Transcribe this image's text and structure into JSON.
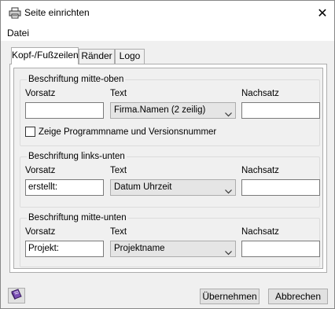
{
  "window": {
    "title": "Seite einrichten",
    "close_glyph": "✕"
  },
  "menu": {
    "items": [
      "Datei"
    ]
  },
  "tabs": [
    {
      "label": "Kopf-/Fußzeilen",
      "active": true
    },
    {
      "label": "Ränder",
      "active": false
    },
    {
      "label": "Logo",
      "active": false
    }
  ],
  "groups": [
    {
      "title": "Beschriftung mitte-oben",
      "prefix_label": "Vorsatz",
      "text_label": "Text",
      "suffix_label": "Nachsatz",
      "prefix_value": "",
      "text_value": "Firma.Namen (2 zeilig)",
      "suffix_value": "",
      "checkbox_label": "Zeige Programmname und Versionsnummer",
      "checkbox_checked": false
    },
    {
      "title": "Beschriftung links-unten",
      "prefix_label": "Vorsatz",
      "text_label": "Text",
      "suffix_label": "Nachsatz",
      "prefix_value": "erstellt:",
      "text_value": "Datum Uhrzeit",
      "suffix_value": ""
    },
    {
      "title": "Beschriftung mitte-unten",
      "prefix_label": "Vorsatz",
      "text_label": "Text",
      "suffix_label": "Nachsatz",
      "prefix_value": "Projekt:",
      "text_value": "Projektname",
      "suffix_value": ""
    }
  ],
  "footer": {
    "ok_label": "Übernehmen",
    "cancel_label": "Abbrechen",
    "help_icon": "book-icon"
  },
  "colors": {
    "accent": "#6a3fa0",
    "border": "#adadad",
    "background": "#f0f0f0"
  }
}
